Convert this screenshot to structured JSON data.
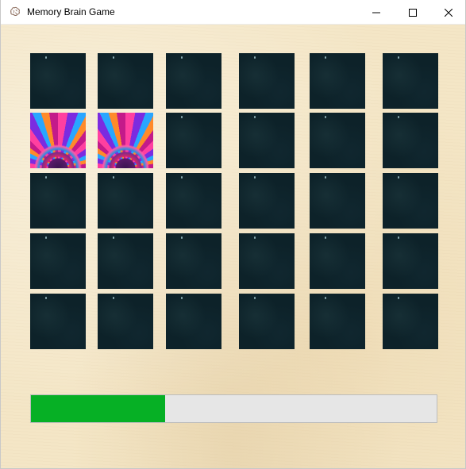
{
  "window": {
    "title": "Memory Brain Game",
    "icon": "brain-icon",
    "controls": [
      "minimize-icon",
      "maximize-icon",
      "close-icon"
    ]
  },
  "board": {
    "rows": 5,
    "columns": 6,
    "revealed_cards": [
      [
        1,
        0
      ],
      [
        1,
        1
      ]
    ],
    "card_back_color": "#0d2229",
    "background_color": "#f4e6c6"
  },
  "progress": {
    "value_fraction": 0.33,
    "fill_color": "#06b025",
    "track_color": "#e6e6e6"
  }
}
